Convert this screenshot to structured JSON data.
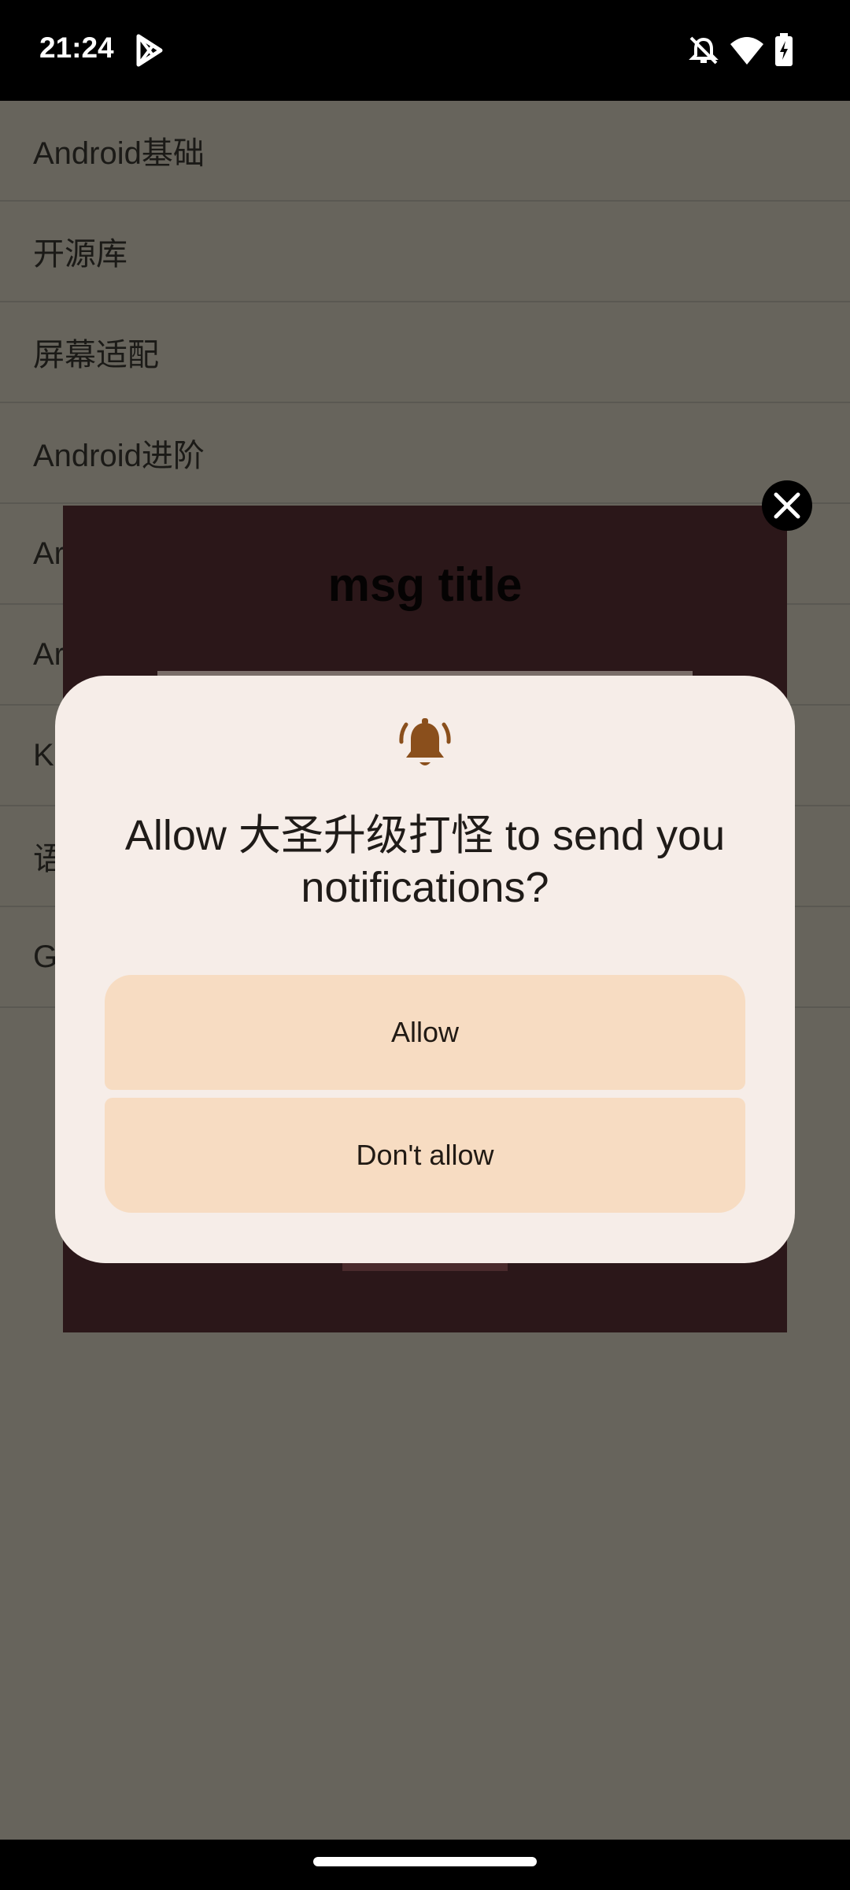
{
  "status_bar": {
    "time": "21:24",
    "icons": [
      "play-store-icon",
      "notifications-off-icon",
      "wifi-icon",
      "battery-charging-icon"
    ]
  },
  "list": {
    "items": [
      {
        "label": "Android基础"
      },
      {
        "label": "开源库"
      },
      {
        "label": "屏幕适配"
      },
      {
        "label": "Android进阶"
      },
      {
        "label": "Ar"
      },
      {
        "label": "Ar"
      },
      {
        "label": "K"
      },
      {
        "label": "语"
      },
      {
        "label": "G"
      }
    ]
  },
  "msg_dialog": {
    "title": "msg title",
    "close_icon": "close-icon"
  },
  "permission_dialog": {
    "icon": "bell-icon",
    "message": "Allow 大圣升级打怪 to send you notifications?",
    "allow_label": "Allow",
    "dont_allow_label": "Don't allow"
  },
  "colors": {
    "scrim": "#67645c",
    "sheet": "#f6ede8",
    "button": "#f7dcc2",
    "accent": "#8a4f1c",
    "dialog_bg": "#2b1719"
  }
}
